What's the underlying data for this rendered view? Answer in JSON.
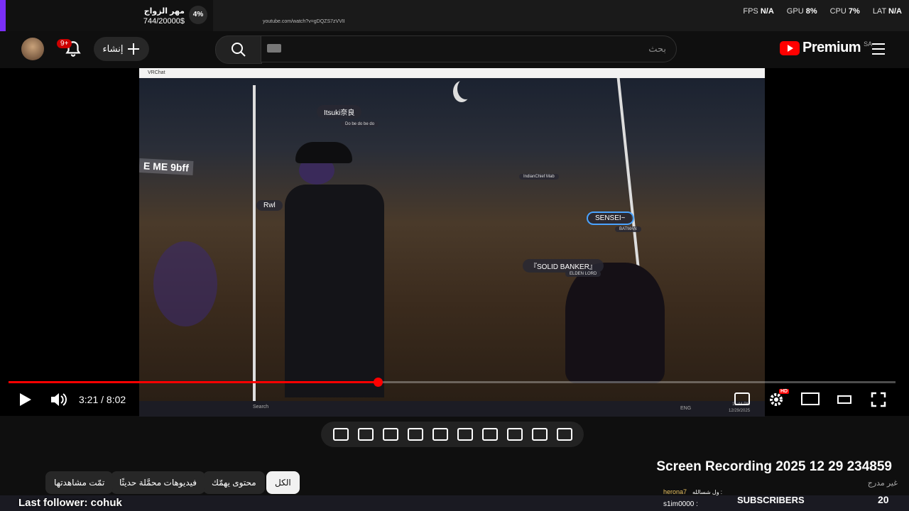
{
  "donation": {
    "title": "مهر الزواج",
    "amount": "744/20000$",
    "percent": "4%"
  },
  "browser": {
    "url": "youtube.com/watch?v=gDQZS7zVVII"
  },
  "perf": [
    {
      "label": "FPS",
      "value": "N/A"
    },
    {
      "label": "GPU",
      "value": "8%"
    },
    {
      "label": "CPU",
      "value": "7%"
    },
    {
      "label": "LAT",
      "value": "N/A"
    }
  ],
  "header": {
    "notification_badge": "9+",
    "create_label": "إنشاء",
    "search_placeholder": "بحث",
    "logo_text": "Premium",
    "region": "SA"
  },
  "vrchat": {
    "window_title": "VRChat",
    "tags": {
      "itsuki": "Itsuki奈良",
      "itsuki_sub": "Do be do be do",
      "meme": "E ME 9bff",
      "rwl": "Rwl",
      "sensei": "SENSEI~",
      "sensei_sub": "BATMAN",
      "banker": "『SOLID BANKER』",
      "banker_sub": "ELDEN LORD",
      "distant": "IndianChief Mab"
    },
    "taskbar_search": "Search",
    "taskbar_lang": "ENG",
    "taskbar_time": "11:44 PM",
    "taskbar_date": "12/29/2025"
  },
  "player": {
    "time": "3:21 / 8:02",
    "progress": 0.417,
    "hd_badge": "HD"
  },
  "video": {
    "title": "Screen Recording 2025 12 29 234859",
    "visibility": "غير مدرج"
  },
  "chips": [
    "الكل",
    "محتوى يهمّك",
    "فيديوهات محمَّلة حديثًا",
    "تمّت مشاهدتها"
  ],
  "overlay": {
    "last_follower": "Last follower: cohuk",
    "subscribers_label": "SUBSCRIBERS",
    "subscribers_count": "20",
    "sub1_name": "herona7",
    "sub1_label": "ول شسالله :",
    "sub2_name": "s1im0000 :"
  },
  "colors": {
    "accent": "#ff0000",
    "donation_bar": "#7b2ff7"
  }
}
